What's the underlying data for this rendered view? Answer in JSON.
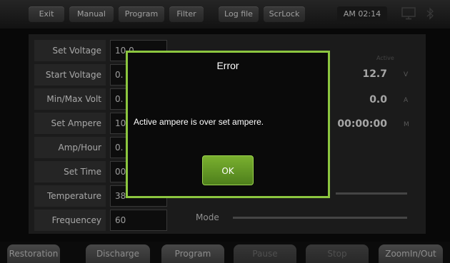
{
  "topbar": {
    "buttons": [
      "Exit",
      "Manual",
      "Program",
      "Filter",
      "Log file",
      "ScrLock"
    ],
    "clock": "AM 02:14"
  },
  "params": [
    {
      "label": "Set Voltage",
      "value": "10.0"
    },
    {
      "label": "Start Voltage",
      "value": "0."
    },
    {
      "label": "Min/Max Volt",
      "value": "0."
    },
    {
      "label": "Set Ampere",
      "value": "10"
    },
    {
      "label": "Amp/Hour",
      "value": "0."
    },
    {
      "label": "Set Time",
      "value": "00"
    },
    {
      "label": "Temperature",
      "value": "38"
    },
    {
      "label": "Frequencey",
      "value": "60"
    }
  ],
  "readout": {
    "active_label": "Active",
    "voltage": "12.7",
    "voltage_unit": "V",
    "ampere": "0.0",
    "ampere_unit": "A",
    "time": "00:00:00",
    "time_unit": "M",
    "mode_label": "Mode"
  },
  "bottombar": {
    "buttons": [
      {
        "label": "Restoration",
        "enabled": true
      },
      {
        "label": "Discharge",
        "enabled": true
      },
      {
        "label": "Program",
        "enabled": true
      },
      {
        "label": "Pause",
        "enabled": false
      },
      {
        "label": "Stop",
        "enabled": false
      },
      {
        "label": "ZoomIn/Out",
        "enabled": true
      }
    ]
  },
  "dialog": {
    "title": "Error",
    "message": "Active ampere is over set ampere.",
    "ok_label": "OK"
  },
  "colors": {
    "accent": "#8cc63f"
  }
}
